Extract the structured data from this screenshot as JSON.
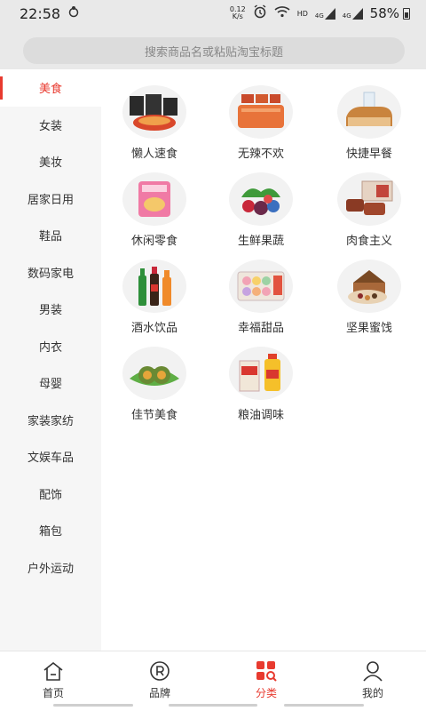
{
  "statusbar": {
    "time": "22:58",
    "net_speed_value": "0.12",
    "net_speed_unit": "K/s",
    "signal_label_1": "HD",
    "signal_label_2": "4G",
    "signal_label_3": "4G",
    "battery": "58%"
  },
  "search": {
    "placeholder": "搜索商品名或粘贴淘宝标题"
  },
  "sidebar": {
    "items": [
      {
        "label": "美食"
      },
      {
        "label": "女装"
      },
      {
        "label": "美妆"
      },
      {
        "label": "居家日用"
      },
      {
        "label": "鞋品"
      },
      {
        "label": "数码家电"
      },
      {
        "label": "男装"
      },
      {
        "label": "内衣"
      },
      {
        "label": "母婴"
      },
      {
        "label": "家装家纺"
      },
      {
        "label": "文娱车品"
      },
      {
        "label": "配饰"
      },
      {
        "label": "箱包"
      },
      {
        "label": "户外运动"
      }
    ]
  },
  "categories": [
    {
      "label": "懒人速食",
      "icon": "instant-noodles-icon"
    },
    {
      "label": "无辣不欢",
      "icon": "spicy-strips-icon"
    },
    {
      "label": "快捷早餐",
      "icon": "bread-milk-icon"
    },
    {
      "label": "休闲零食",
      "icon": "snack-bag-icon"
    },
    {
      "label": "生鲜果蔬",
      "icon": "fresh-fruit-icon"
    },
    {
      "label": "肉食主义",
      "icon": "meat-box-icon"
    },
    {
      "label": "酒水饮品",
      "icon": "drinks-icon"
    },
    {
      "label": "幸福甜品",
      "icon": "macaron-icon"
    },
    {
      "label": "坚果蜜饯",
      "icon": "nuts-box-icon"
    },
    {
      "label": "佳节美食",
      "icon": "rice-dumpling-icon"
    },
    {
      "label": "粮油调味",
      "icon": "rice-oil-icon"
    }
  ],
  "bottomnav": {
    "items": [
      {
        "label": "首页",
        "icon": "home-icon"
      },
      {
        "label": "品牌",
        "icon": "registered-icon"
      },
      {
        "label": "分类",
        "icon": "category-icon"
      },
      {
        "label": "我的",
        "icon": "user-icon"
      }
    ]
  },
  "colors": {
    "accent": "#e83a2f",
    "sidebar_bg": "#f6f6f6",
    "header_bg": "#e9e9e9"
  }
}
